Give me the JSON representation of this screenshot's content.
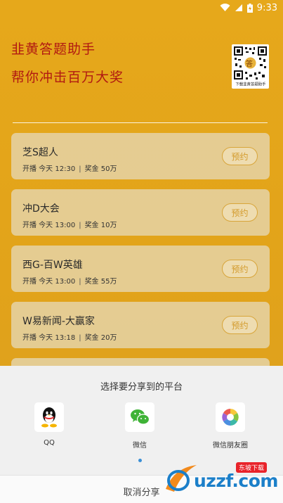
{
  "status_bar": {
    "time": "9:33"
  },
  "header": {
    "title_line1": "韭黄答题助手",
    "title_line2": "帮你冲击百万大奖",
    "qr_caption": "下载韭黄答题助手",
    "qr_center_char": "答"
  },
  "games": [
    {
      "name": "芝S超人",
      "time": "开播 今天 12:30",
      "prize": "奖金 50万",
      "button": "预约"
    },
    {
      "name": "冲D大会",
      "time": "开播 今天 13:00",
      "prize": "奖金 10万",
      "button": "预约"
    },
    {
      "name": "西G-百W英雄",
      "time": "开播 今天 13:00",
      "prize": "奖金 55万",
      "button": "预约"
    },
    {
      "name": "W易新闻-大赢家",
      "time": "开播 今天 13:18",
      "prize": "奖金 20万",
      "button": "预约"
    }
  ],
  "share_sheet": {
    "title": "选择要分享到的平台",
    "platforms": [
      {
        "label": "QQ",
        "icon": "qq-icon"
      },
      {
        "label": "微信",
        "icon": "wechat-icon"
      },
      {
        "label": "微信朋友圈",
        "icon": "moments-icon"
      }
    ],
    "cancel_label": "取消分享"
  },
  "watermark": {
    "text": "uzzf.com",
    "badge": "东坡下载"
  },
  "colors": {
    "background": "#e2a31a",
    "title": "#b11a12",
    "accent": "#d39a2a",
    "sheet": "#f0f0f0"
  }
}
